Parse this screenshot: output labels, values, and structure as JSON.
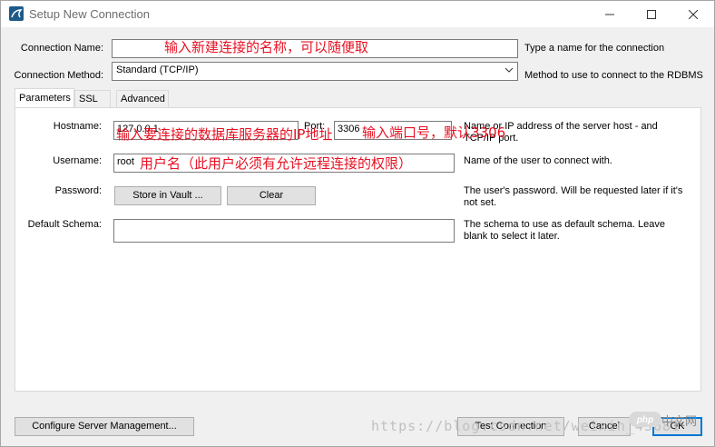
{
  "window": {
    "title": "Setup New Connection"
  },
  "form": {
    "connection_name_label": "Connection Name:",
    "connection_name_value": "",
    "connection_name_hint": "Type a name for the connection",
    "connection_method_label": "Connection Method:",
    "connection_method_value": "Standard (TCP/IP)",
    "connection_method_hint": "Method to use to connect to the RDBMS"
  },
  "tabs": [
    {
      "label": "Parameters",
      "active": true
    },
    {
      "label": "SSL",
      "active": false
    },
    {
      "label": "Advanced",
      "active": false
    }
  ],
  "parameters": {
    "hostname_label": "Hostname:",
    "hostname_value": "127.0.0.1",
    "port_label": "Port:",
    "port_value": "3306",
    "hostname_hint": "Name or IP address of the server host - and TCP/IP port.",
    "username_label": "Username:",
    "username_value": "root",
    "username_hint": "Name of the user to connect with.",
    "password_label": "Password:",
    "store_in_vault_label": "Store in Vault ...",
    "clear_label": "Clear",
    "password_hint": "The user's password. Will be requested later if it's not set.",
    "default_schema_label": "Default Schema:",
    "default_schema_value": "",
    "default_schema_hint": "The schema to use as default schema. Leave blank to select it later."
  },
  "buttons": {
    "configure_label": "Configure Server Management...",
    "test_label": "Test Connection",
    "cancel_label": "Cancel",
    "ok_label": "OK"
  },
  "annotations": {
    "name": "输入新建连接的名称，可以随便取",
    "hostname": "输入要连接的数据库服务器的IP地址",
    "port": "输入端口号，默认3306",
    "username": "用户名（此用户必须有允许远程连接的权限）"
  },
  "overlay": {
    "watermark": "https://blog.csdn.net/weixin_43681",
    "badge_text": "中文网"
  },
  "colors": {
    "annotation": "#e81123",
    "default_button_border": "#0078d7"
  }
}
